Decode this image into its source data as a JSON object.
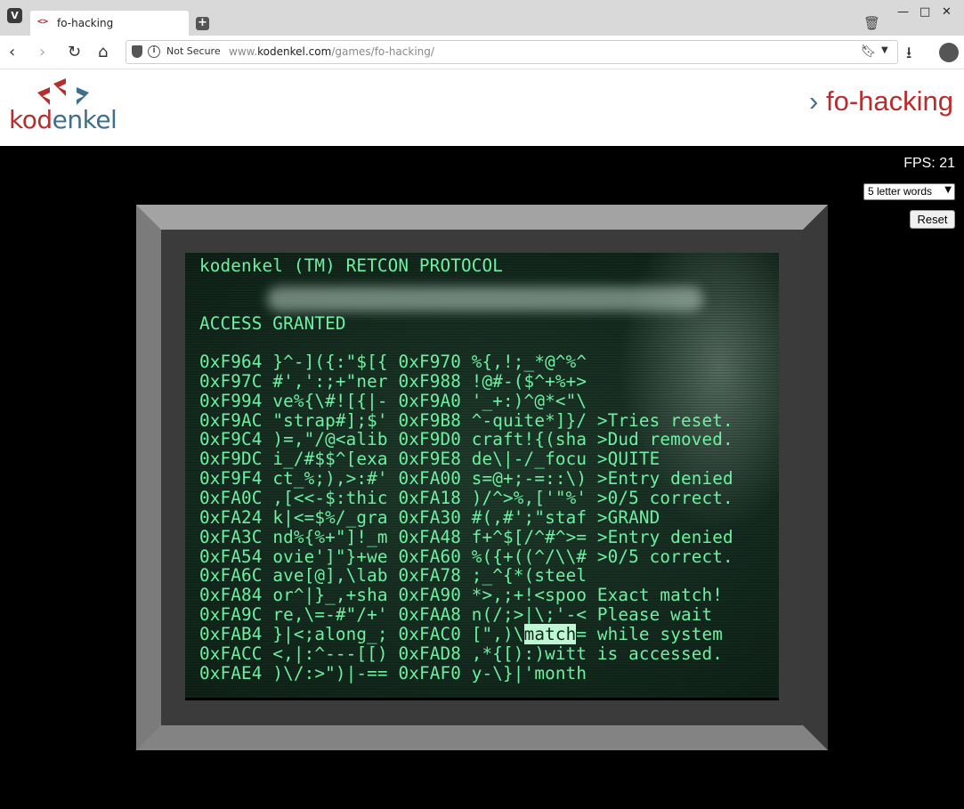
{
  "browser": {
    "tab_title": "fo-hacking",
    "tab_favicon": "<>",
    "not_secure": "Not Secure",
    "url_host": "www.kodenkel.com",
    "url_path": "/games/fo-hacking/",
    "url_prefix": "www.",
    "url_domain": "kodenkel.com",
    "icons": [
      "vivaldi-icon",
      "new-tab-icon",
      "trash-icon",
      "minimize-icon",
      "maximize-icon",
      "close-icon",
      "back-icon",
      "forward-icon",
      "reload-icon",
      "home-icon",
      "shield-icon",
      "info-icon",
      "bookmark-icon",
      "dropdown-icon",
      "download-icon",
      "profile-icon"
    ]
  },
  "site": {
    "logo_prefix": "kod",
    "logo_suffix": "enkel",
    "page_title_chevron": "›",
    "page_title": "fo-hacking",
    "colors": {
      "brand_red": "#b62e2e",
      "brand_blue": "#3f6f89"
    }
  },
  "game": {
    "fps_label": "FPS: 21",
    "word_length_select": "5 letter words",
    "reset_label": "Reset",
    "terminal_color": "#6ef0a0",
    "header_line": "kodenkel (TM) RETCON PROTOCOL",
    "access_line": "ACCESS GRANTED",
    "rows": [
      {
        "a1": "0xF964",
        "d1": "}^-]({:\"$[{",
        "a2": "0xF970",
        "d2": "%{,!;_*@^%^",
        "log": ""
      },
      {
        "a1": "0xF97C",
        "d1": "#',':;+\"ner",
        "a2": "0xF988",
        "d2": "!@#-($^+%+>",
        "log": ""
      },
      {
        "a1": "0xF994",
        "d1": "ve%{\\#![{|-",
        "a2": "0xF9A0",
        "d2": "'_+:)^@*<\"\\",
        "log": ""
      },
      {
        "a1": "0xF9AC",
        "d1": "\"strap#];$'",
        "a2": "0xF9B8",
        "d2": "^-quite*]}/",
        "log": ">Tries reset."
      },
      {
        "a1": "0xF9C4",
        "d1": ")=,\"/@<alib",
        "a2": "0xF9D0",
        "d2": "craft!{(sha",
        "log": ">Dud removed."
      },
      {
        "a1": "0xF9DC",
        "d1": "i_/#$$^[exa",
        "a2": "0xF9E8",
        "d2": "de\\|-/_focu",
        "log": ">QUITE"
      },
      {
        "a1": "0xF9F4",
        "d1": "ct_%;),>:#'",
        "a2": "0xFA00",
        "d2": "s=@+;-=::\\)",
        "log": ">Entry denied"
      },
      {
        "a1": "0xFA0C",
        "d1": ",[<<-$:thic",
        "a2": "0xFA18",
        "d2": ")/^>%,['\"%'",
        "log": ">0/5 correct."
      },
      {
        "a1": "0xFA24",
        "d1": "k|<=$%/_gra",
        "a2": "0xFA30",
        "d2": "#(,#';\"staf",
        "log": ">GRAND"
      },
      {
        "a1": "0xFA3C",
        "d1": "nd%{%+\"]!_m",
        "a2": "0xFA48",
        "d2": "f+^$[/^#^>=",
        "log": ">Entry denied"
      },
      {
        "a1": "0xFA54",
        "d1": "ovie']\"}+we",
        "a2": "0xFA60",
        "d2": "%({+((^/\\\\#",
        "log": ">0/5 correct."
      },
      {
        "a1": "0xFA6C",
        "d1": "ave[@],\\lab",
        "a2": "0xFA78",
        "d2": ";_^{*(steel",
        "log": ""
      },
      {
        "a1": "0xFA84",
        "d1": "or^|}_,+sha",
        "a2": "0xFA90",
        "d2": "*>,;+!<spoo",
        "log": "Exact match!"
      },
      {
        "a1": "0xFA9C",
        "d1": "re,\\=-#\"/+'",
        "a2": "0xFAA8",
        "d2": "n(/;>|\\;'-<",
        "log": "Please wait"
      },
      {
        "a1": "0xFAB4",
        "d1": "}|<;along_;",
        "a2": "0xFAC0",
        "d2pre": "[\",)\\",
        "d2hl": "match",
        "d2post": "=",
        "log": "while system"
      },
      {
        "a1": "0xFACC",
        "d1": "<,|:^---[[)",
        "a2": "0xFAD8",
        "d2": ",*{[):)witt",
        "log": "is accessed."
      },
      {
        "a1": "0xFAE4",
        "d1": ")\\/:>\")|-==",
        "a2": "0xFAF0",
        "d2": "y-\\}|'month",
        "log": ""
      }
    ]
  }
}
